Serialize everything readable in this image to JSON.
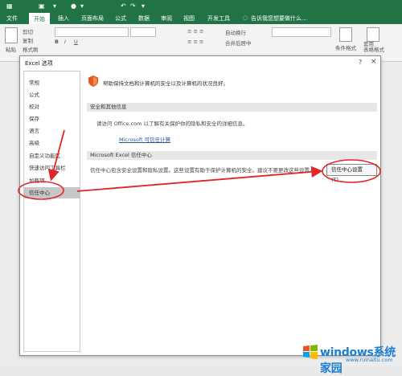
{
  "titlebar": {
    "quick_access": [
      "↶",
      "↷",
      "▾"
    ]
  },
  "menu": {
    "tabs": [
      "文件",
      "开始",
      "插入",
      "页面布局",
      "公式",
      "数据",
      "审阅",
      "视图",
      "开发工具"
    ],
    "active_tab": "开始",
    "tell_me": "告诉我您想要做什么..."
  },
  "ribbon": {
    "paste": "粘贴",
    "cut": "剪切",
    "copy": "复制",
    "format_painter": "格式刷",
    "wrap_text": "自动换行",
    "merge_center": "合并后居中",
    "conditional_format": "条件格式",
    "table_format": "套用\n表格格式"
  },
  "dialog": {
    "title": "Excel 选项",
    "help": "?",
    "close": "×",
    "nav_items": [
      "常规",
      "公式",
      "校对",
      "保存",
      "语言",
      "高级",
      "自定义功能区",
      "快速访问工具栏",
      "加载项",
      "信任中心"
    ],
    "selected_nav": "信任中心",
    "header_text": "帮助保持文档和计算机的安全以及计算机的状况良好。",
    "section1_title": "安全和其他信息",
    "section1_text": "请访问 Office.com 以了解有关保护你的隐私和安全的详细信息。",
    "section1_link": "Microsoft 可信任计算",
    "section2_title": "Microsoft Excel 信任中心",
    "section2_text": "信任中心包含安全设置和隐私设置。这些设置有助于保护计算机的安全。建议不要更改这些设置。",
    "trust_center_button": "信任中心设置(T)..."
  },
  "watermark": {
    "brand": "windows系统家园",
    "url": "www.ruinaitu.com"
  },
  "colors": {
    "excel_green": "#217346",
    "annotation_red": "#e0262a",
    "shield": "#e05a1e"
  }
}
